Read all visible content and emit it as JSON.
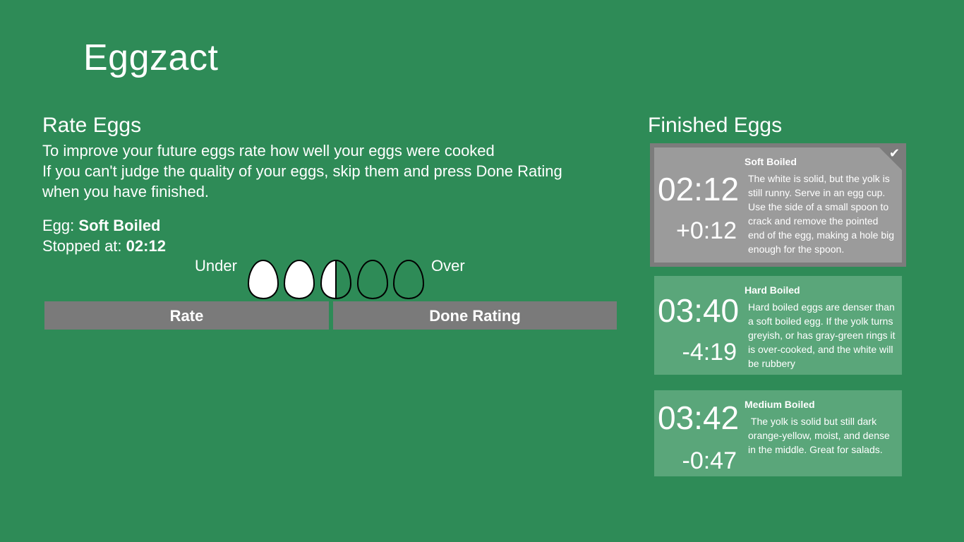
{
  "app": {
    "title": "Eggzact"
  },
  "rate": {
    "title": "Rate Eggs",
    "instruction_lines": [
      "To improve your future eggs rate how well your eggs were cooked",
      "If you can't judge the quality of your eggs, skip them and press Done Rating",
      "when you have finished."
    ],
    "egg_label": "Egg:",
    "egg_value": "Soft Boiled",
    "stopped_label": "Stopped at:",
    "stopped_value": "02:12",
    "under_label": "Under",
    "over_label": "Over",
    "rating_scale": [
      "too-under",
      "under",
      "perfect",
      "over",
      "too-over"
    ],
    "selected_rating_index": 2,
    "rate_button": "Rate",
    "done_button": "Done Rating"
  },
  "finished": {
    "title": "Finished Eggs",
    "cards": [
      {
        "name": "Soft Boiled",
        "time": "02:12",
        "delta": "+0:12",
        "description": "The white is solid, but the yolk is still runny. Serve in an egg cup. Use the side of a small spoon to crack and remove the pointed end of the egg, making a hole big enough for the spoon.",
        "selected": true,
        "icon": "checkmark-icon"
      },
      {
        "name": "Hard Boiled",
        "time": "03:40",
        "delta": "-4:19",
        "description": "Hard boiled eggs are denser than a soft boiled egg. If the yolk turns greyish, or has gray-green rings it is over-cooked, and the white will be rubbery",
        "selected": false
      },
      {
        "name": "Medium Boiled",
        "time": "03:42",
        "delta": "-0:47",
        "description": " The yolk is solid but still dark orange-yellow, moist, and dense in the middle. Great for salads.",
        "selected": false
      }
    ]
  },
  "colors": {
    "background": "#2e8b57",
    "button": "#7a7a7a",
    "card": "#5aa67a",
    "card_selected": "#9b9b9b",
    "card_selected_border": "#7c7c7c"
  }
}
